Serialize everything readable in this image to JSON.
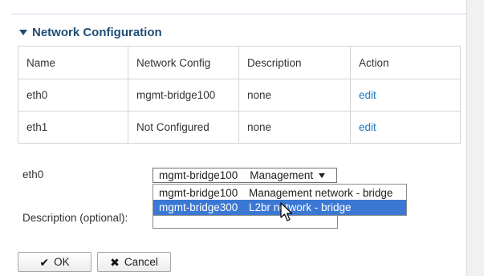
{
  "section": {
    "title": "Network Configuration",
    "icon": "triangle-down-icon"
  },
  "table": {
    "headers": [
      "Name",
      "Network Config",
      "Description",
      "Action"
    ],
    "rows": [
      {
        "name": "eth0",
        "config": "mgmt-bridge100",
        "description": "none",
        "action": "edit"
      },
      {
        "name": "eth1",
        "config": "Not Configured",
        "description": "none",
        "action": "edit"
      }
    ]
  },
  "form": {
    "interface_label": "eth0",
    "description_label": "Description (optional):",
    "description_value": "",
    "select": {
      "selected_name": "mgmt-bridge100",
      "selected_desc": "Management"
    },
    "options": [
      {
        "name": "mgmt-bridge100",
        "desc": "Management network - bridge",
        "highlighted": false
      },
      {
        "name": "mgmt-bridge300",
        "desc": "L2br network - bridge",
        "highlighted": true
      }
    ]
  },
  "buttons": {
    "ok": {
      "label": "OK",
      "icon": "checkmark-icon"
    },
    "cancel": {
      "label": "Cancel",
      "icon": "x-icon"
    }
  },
  "colors": {
    "accent": "#1f4d75",
    "link": "#1a77c0",
    "highlight": "#3b78d4"
  }
}
